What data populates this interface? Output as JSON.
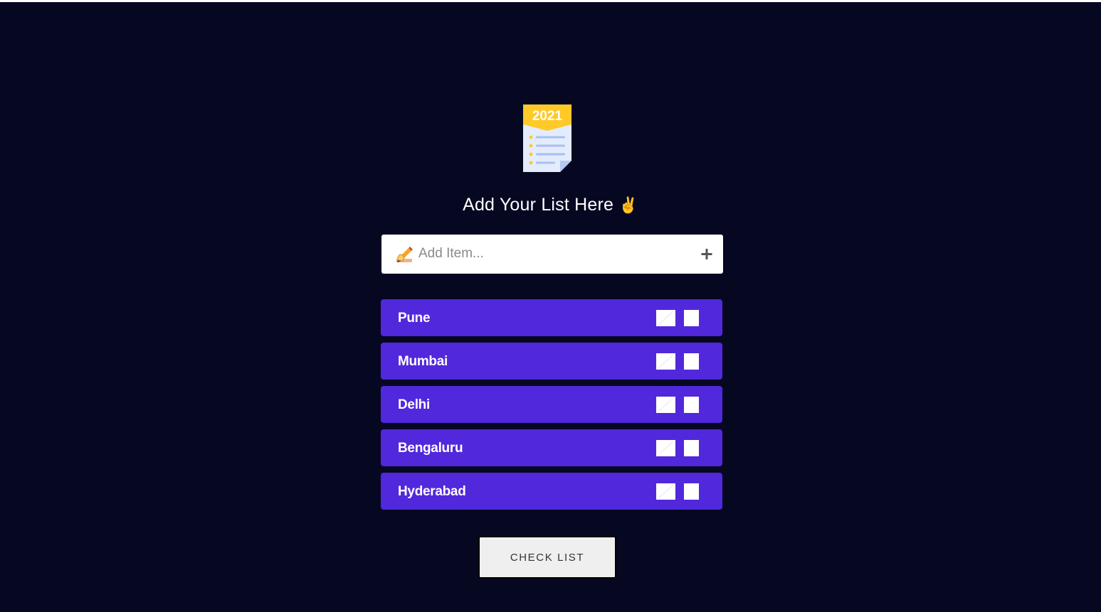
{
  "logo": {
    "year": "2021",
    "icon": "checklist-doc-icon"
  },
  "heading": {
    "text": "Add Your List Here",
    "emoji": "✌"
  },
  "add_item": {
    "placeholder": "Add Item...",
    "value": "",
    "pencil_icon": "writing-hand-icon",
    "add_icon": "plus-icon"
  },
  "list": {
    "items": [
      {
        "label": "Pune"
      },
      {
        "label": "Mumbai"
      },
      {
        "label": "Delhi"
      },
      {
        "label": "Bengaluru"
      },
      {
        "label": "Hyderabad"
      }
    ]
  },
  "check_button": {
    "label": "CHECK LIST"
  },
  "colors": {
    "background": "#060822",
    "item_bg": "#5128db",
    "logo_banner": "#ffc928",
    "text": "#ffffff"
  }
}
